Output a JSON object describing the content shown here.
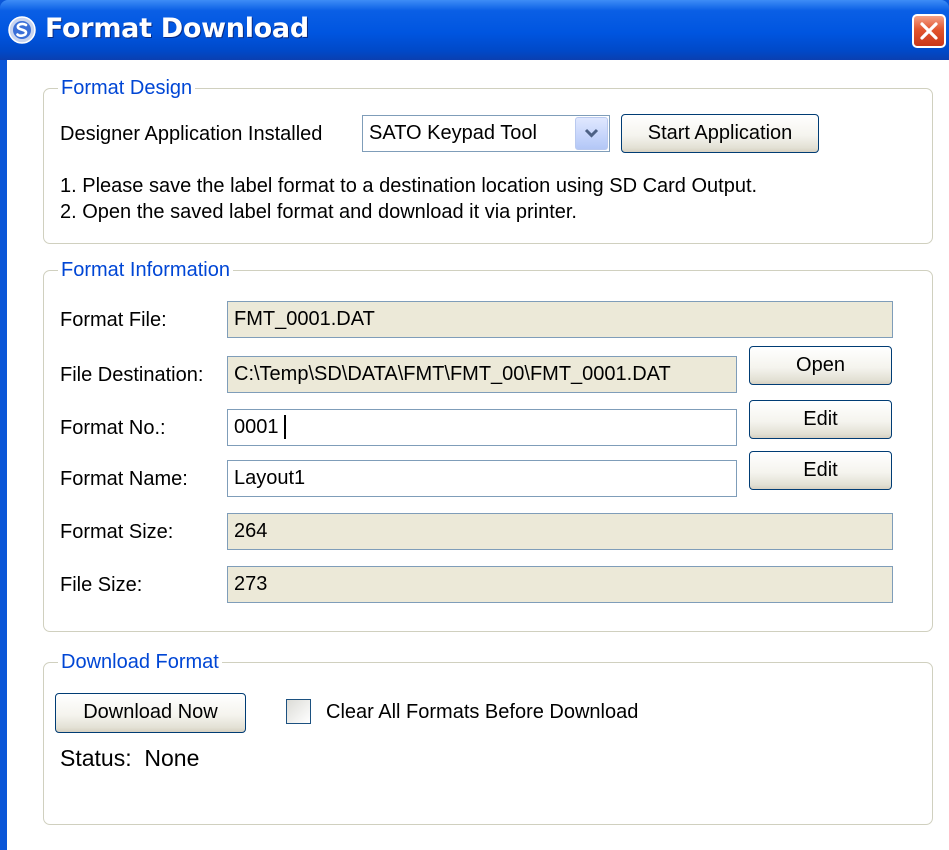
{
  "window": {
    "title": "Format Download",
    "colors": {
      "titlebar": "#0055E0",
      "close": "#E2552E",
      "legend": "#0046D5",
      "readonly_field": "#ECE9D8"
    }
  },
  "format_design": {
    "legend": "Format Design",
    "designer_label": "Designer Application Installed",
    "designer_select": "SATO Keypad Tool",
    "start_button": "Start Application",
    "instruction1": "1. Please save the label format to a destination location using SD Card Output.",
    "instruction2": "2. Open the saved label format and download it via printer."
  },
  "format_info": {
    "legend": "Format Information",
    "format_file_label": "Format File:",
    "format_file_value": "FMT_0001.DAT",
    "file_dest_label": "File Destination:",
    "file_dest_value": "C:\\Temp\\SD\\DATA\\FMT\\FMT_00\\FMT_0001.DAT",
    "open_button": "Open",
    "format_no_label": "Format No.:",
    "format_no_value": "0001",
    "edit_no_button": "Edit",
    "format_name_label": "Format Name:",
    "format_name_value": "Layout1",
    "edit_name_button": "Edit",
    "format_size_label": "Format Size:",
    "format_size_value": "264",
    "file_size_label": "File Size:",
    "file_size_value": "273"
  },
  "download": {
    "legend": "Download Format",
    "download_button": "Download Now",
    "clear_checkbox_label": "Clear All Formats Before Download",
    "clear_checked": false,
    "status_label": "Status:",
    "status_value": "None"
  },
  "icons": {
    "app": "sato-logo-icon",
    "close": "close-icon",
    "dropdown": "chevron-down-icon"
  }
}
